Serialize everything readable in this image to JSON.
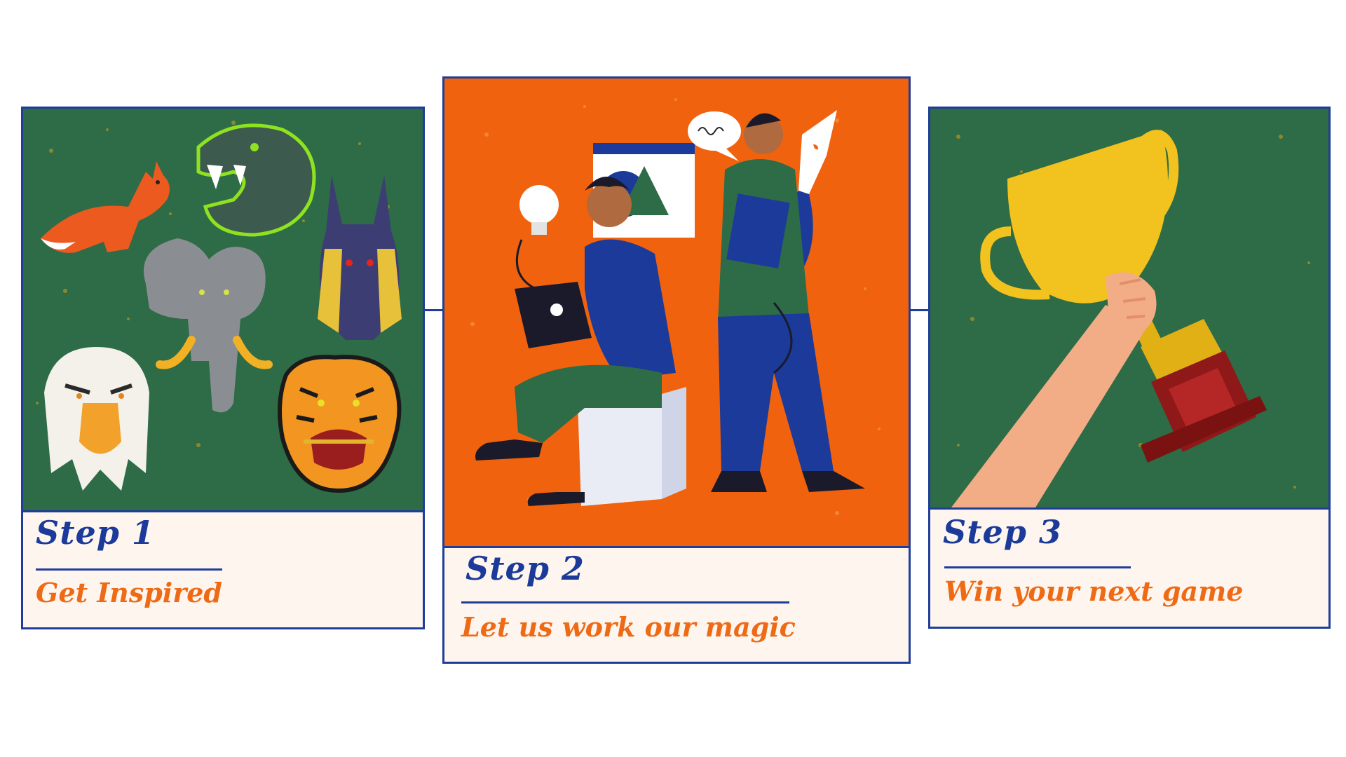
{
  "colors": {
    "accent_blue": "#1b3a9a",
    "accent_orange": "#ef6a15",
    "panel_green": "#2e6b47",
    "panel_orange": "#f0620e",
    "caption_bg": "#fdf5ee"
  },
  "steps": [
    {
      "title": "Step 1",
      "text": "Get Inspired",
      "illustration": "animal-mascots-illustration"
    },
    {
      "title": "Step 2",
      "text": "Let us work our magic",
      "illustration": "designers-working-illustration"
    },
    {
      "title": "Step 3",
      "text": "Win your next game",
      "illustration": "trophy-in-hand-illustration"
    }
  ]
}
